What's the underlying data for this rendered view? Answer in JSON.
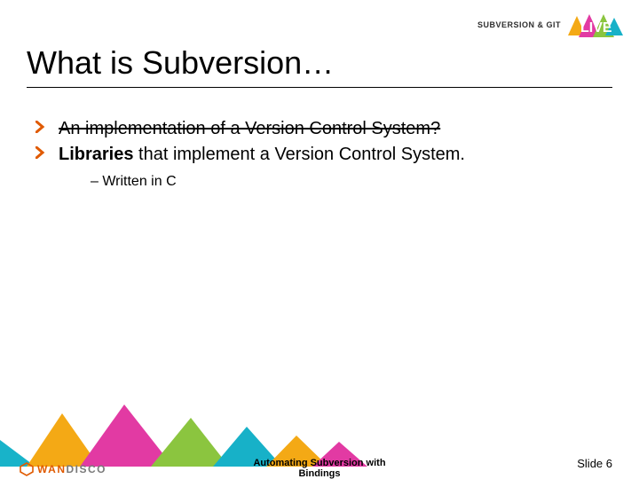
{
  "branding": {
    "text": "SUBVERSION & GIT",
    "live": "LIVE"
  },
  "title": "What is Subversion…",
  "bullets": [
    {
      "text": "An implementation of a Version Control System?",
      "strike": true
    },
    {
      "text_prefix_bold": "Libraries",
      "text_rest": " that implement a Version Control System.",
      "strike": false,
      "sub": [
        "Written in C"
      ]
    }
  ],
  "footer": {
    "center_line1": "Automating Subversion with",
    "center_line2": "Bindings",
    "slide_label": "Slide 6",
    "wandisco_wan": "WAN",
    "wandisco_disco": "DISCO"
  }
}
